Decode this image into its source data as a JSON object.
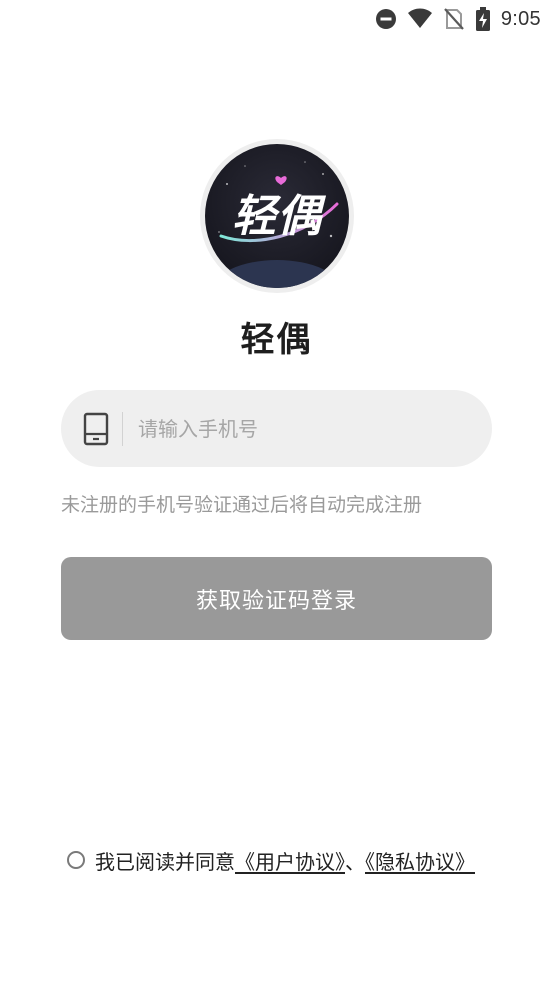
{
  "status_bar": {
    "time": "9:05",
    "icons": [
      "do-not-disturb-icon",
      "wifi-icon",
      "no-sim-icon",
      "battery-charging-icon"
    ]
  },
  "app": {
    "logo_text": "轻偶",
    "name": "轻偶"
  },
  "login": {
    "phone_icon": "phone-icon",
    "phone_placeholder": "请输入手机号",
    "phone_value": "",
    "hint": "未注册的手机号验证通过后将自动完成注册",
    "submit_label": "获取验证码登录"
  },
  "agreement": {
    "prefix": "我已阅读并同意",
    "user_agreement": "《用户协议》",
    "separator": "、",
    "privacy_agreement": "《隐私协议》",
    "checked": false
  },
  "colors": {
    "button_bg": "#999999",
    "field_bg": "#efefef",
    "hint_text": "#9a9a9a",
    "logo_bg": "#1f1f2b",
    "logo_accent": "#e86bd8"
  }
}
